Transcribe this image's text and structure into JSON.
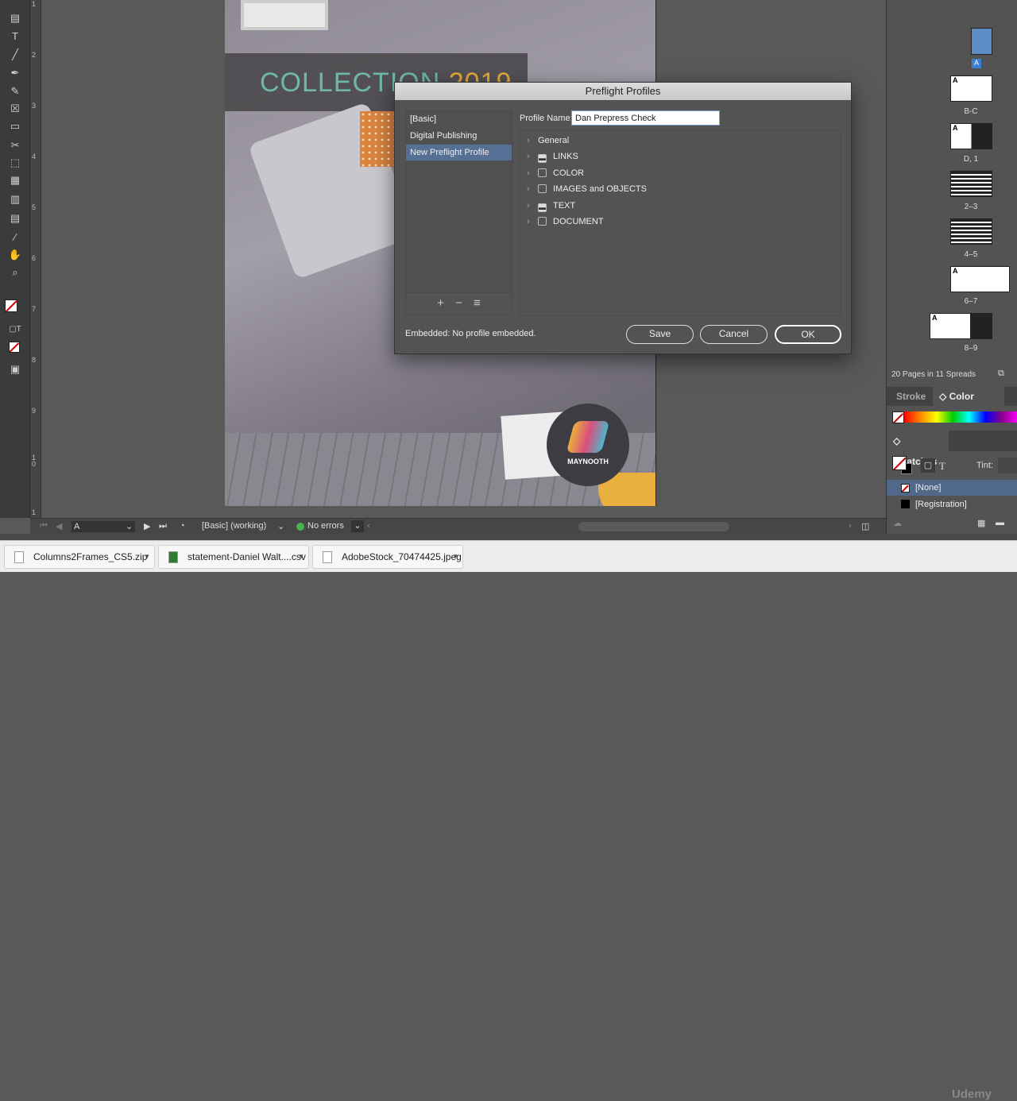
{
  "document": {
    "headline_a": "COLLECTION ",
    "headline_b": "2019",
    "logo_text": "MAYNOOTH"
  },
  "ruler": {
    "marks": [
      "1",
      "2",
      "3",
      "4",
      "5",
      "6",
      "7",
      "8",
      "9",
      "1 0",
      "1"
    ]
  },
  "dialog": {
    "title": "Preflight Profiles",
    "profiles": [
      {
        "label": "[Basic]",
        "selected": false
      },
      {
        "label": "Digital Publishing",
        "selected": false
      },
      {
        "label": "New Preflight Profile",
        "selected": true
      }
    ],
    "list_buttons": {
      "add": "+",
      "remove": "−",
      "menu": "≡"
    },
    "profile_name_label": "Profile Name:",
    "profile_name_value": "Dan Prepress Check",
    "tree": [
      {
        "label": "General",
        "checkbox": null
      },
      {
        "label": "LINKS",
        "checkbox": "mixed"
      },
      {
        "label": "COLOR",
        "checkbox": "unchecked"
      },
      {
        "label": "IMAGES and OBJECTS",
        "checkbox": "unchecked"
      },
      {
        "label": "TEXT",
        "checkbox": "mixed"
      },
      {
        "label": "DOCUMENT",
        "checkbox": "unchecked"
      }
    ],
    "embedded": "Embedded: No profile embedded.",
    "save": "Save",
    "cancel": "Cancel",
    "ok": "OK"
  },
  "pages_panel": {
    "spreads": [
      {
        "label": "B-C"
      },
      {
        "label": "D, 1"
      },
      {
        "label": "2–3"
      },
      {
        "label": "4–5"
      },
      {
        "label": "6–7"
      },
      {
        "label": "8–9"
      }
    ],
    "master_letter": "A",
    "count": "20 Pages in 11 Spreads"
  },
  "color_panel": {
    "tab_stroke": "Stroke",
    "tab_color": "Color"
  },
  "swatches_panel": {
    "title": "Swatches",
    "tint_label": "Tint:",
    "type_icon": "T",
    "items": [
      {
        "label": "[None]",
        "selected": true
      },
      {
        "label": "[Registration]",
        "selected": false
      }
    ]
  },
  "status_bar": {
    "page": "A",
    "preflight_profile": "[Basic] (working)",
    "errors": "No errors",
    "ok_color": "#4caf50"
  },
  "downloads": [
    {
      "name": "Columns2Frames_CS5.zip"
    },
    {
      "name": "statement-Daniel Walt....csv"
    },
    {
      "name": "AdobeStock_70474425.jpeg"
    }
  ],
  "branding": {
    "udemy": "Udemy"
  }
}
